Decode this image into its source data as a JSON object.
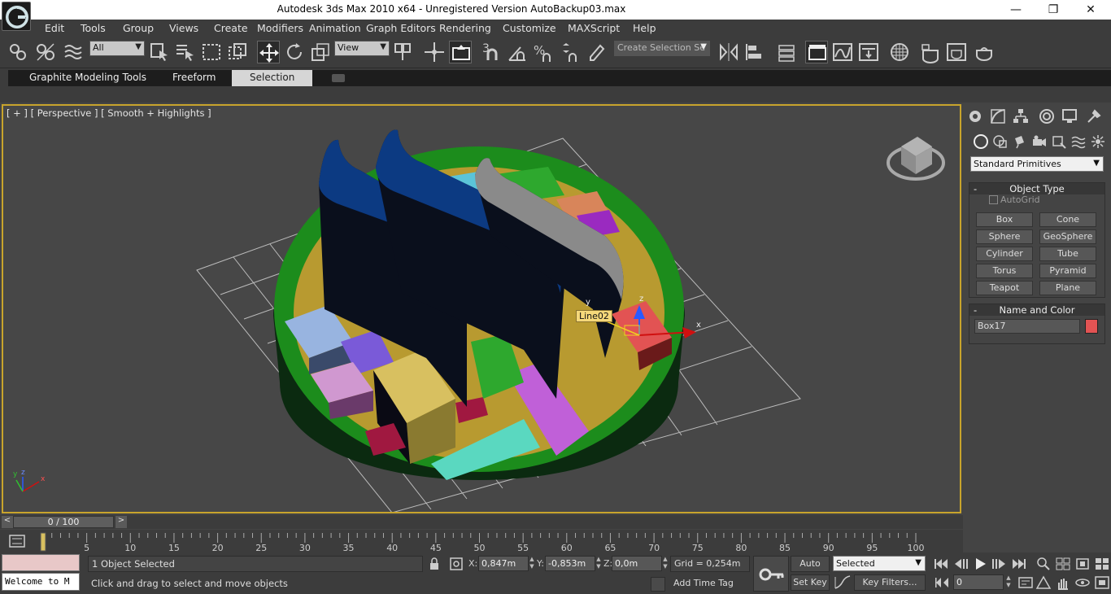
{
  "window": {
    "title": "Autodesk 3ds Max  2010 x64  - Unregistered Version     AutoBackup03.max",
    "minimize": "—",
    "maximize": "❐",
    "close": "✕"
  },
  "menu": [
    "Edit",
    "Tools",
    "Group",
    "Views",
    "Create",
    "Modifiers",
    "Animation",
    "Graph Editors",
    "Rendering",
    "Customize",
    "MAXScript",
    "Help"
  ],
  "toolbar": {
    "selection_filter": "All",
    "reference_coord": "View",
    "named_selection_placeholder": "Create Selection Se",
    "snap_label": "3",
    "active_tool": "select-and-move"
  },
  "ribbon": {
    "tabs": [
      "Graphite Modeling Tools",
      "Freeform",
      "Selection"
    ],
    "active_tab": "Selection"
  },
  "viewport": {
    "label": "[ + ] [ Perspective ] [ Smooth + Highlights ]",
    "object_tag": "Line02",
    "gizmo_x": "x",
    "gizmo_y": "y",
    "gizmo_z": "z",
    "axis_x": "x",
    "axis_y": "y",
    "axis_z": "z",
    "border_color": "#c8a42c"
  },
  "command_panel": {
    "category": "Standard Primitives",
    "object_type": {
      "title": "Object Type",
      "autogrid": "AutoGrid",
      "buttons": [
        "Box",
        "Cone",
        "Sphere",
        "GeoSphere",
        "Cylinder",
        "Tube",
        "Torus",
        "Pyramid",
        "Teapot",
        "Plane"
      ]
    },
    "name_color": {
      "title": "Name and Color",
      "name": "Box17",
      "color": "#e25353"
    }
  },
  "time_slider": {
    "frame_display": "0 / 100",
    "current": 0,
    "end": 100
  },
  "track": {
    "ticks": [
      5,
      10,
      15,
      20,
      25,
      30,
      35,
      40,
      45,
      50,
      55,
      60,
      65,
      70,
      75,
      80,
      85,
      90,
      95,
      100
    ]
  },
  "status": {
    "listener_text": "Welcome to M",
    "selection_info": "1 Object Selected",
    "prompt": "Click and drag to select and move objects",
    "x_label": "X:",
    "x_value": "0,847m",
    "y_label": "Y:",
    "y_value": "-0,853m",
    "z_label": "Z:",
    "z_value": "0,0m",
    "grid": "Grid = 0,254m",
    "add_time_tag": "Add Time Tag",
    "auto_key": "Auto Key",
    "set_key": "Set Key",
    "key_mode": "Selected",
    "key_filters": "Key Filters...",
    "current_frame": "0"
  }
}
